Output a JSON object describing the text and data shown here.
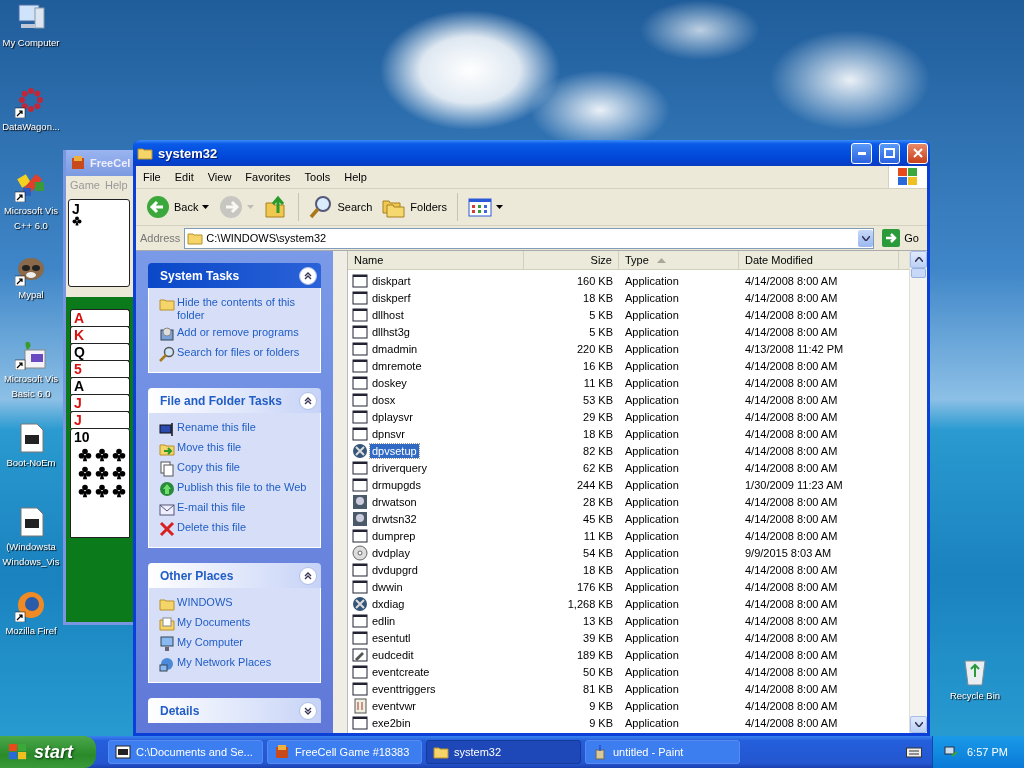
{
  "desktop_icons": [
    {
      "label_lines": [
        "My Computer"
      ],
      "kind": "computer",
      "shortcut": false
    },
    {
      "label_lines": [
        "DataWagon..."
      ],
      "kind": "dots",
      "shortcut": true
    },
    {
      "label_lines": [
        "Microsoft Vis",
        "C++ 6.0"
      ],
      "kind": "blocks",
      "shortcut": true
    },
    {
      "label_lines": [
        "Mypal"
      ],
      "kind": "raccoon",
      "shortcut": true
    },
    {
      "label_lines": [
        "Microsoft Vis",
        "Basic 6.0"
      ],
      "kind": "plant",
      "shortcut": true
    },
    {
      "label_lines": [
        "Boot-NoEm"
      ],
      "kind": "archive",
      "shortcut": false
    },
    {
      "label_lines": [
        "(Windowsta",
        "Windows_Vis"
      ],
      "kind": "archive",
      "shortcut": false
    },
    {
      "label_lines": [
        "Mozilla Firef"
      ],
      "kind": "firefox",
      "shortcut": true
    }
  ],
  "recycle_bin": {
    "label": "Recycle Bin"
  },
  "freecell": {
    "title": "FreeCel",
    "menu": [
      "Game",
      "Help"
    ],
    "free_card": {
      "rank": "J",
      "color": "#000000"
    },
    "column": [
      {
        "rank": "A",
        "color": "#d81010"
      },
      {
        "rank": "K",
        "color": "#d81010"
      },
      {
        "rank": "Q",
        "color": "#000000"
      },
      {
        "rank": "5",
        "color": "#d81010"
      },
      {
        "rank": "A",
        "color": "#000000"
      },
      {
        "rank": "J",
        "color": "#d81010"
      },
      {
        "rank": "J",
        "color": "#d81010"
      },
      {
        "rank": "10",
        "color": "#000000"
      }
    ]
  },
  "window": {
    "title": "system32",
    "menu": [
      "File",
      "Edit",
      "View",
      "Favorites",
      "Tools",
      "Help"
    ],
    "toolbar": [
      {
        "kind": "back",
        "label": "Back",
        "disabled": false
      },
      {
        "kind": "forward",
        "disabled": true
      },
      {
        "kind": "up",
        "disabled": false
      },
      {
        "kind": "search",
        "label": "Search",
        "disabled": false
      },
      {
        "kind": "folders",
        "label": "Folders",
        "disabled": false
      },
      {
        "kind": "views",
        "disabled": false
      }
    ],
    "address": {
      "label": "Address",
      "value": "C:\\WINDOWS\\system32",
      "go": "Go"
    },
    "task_panels": [
      {
        "title": "System Tasks",
        "expanded": true,
        "kind": "primary",
        "items": [
          {
            "label": "Hide the contents of this folder",
            "kind": "hide"
          },
          {
            "label": "Add or remove programs",
            "kind": "addremove"
          },
          {
            "label": "Search for files or folders",
            "kind": "search"
          }
        ]
      },
      {
        "title": "File and Folder Tasks",
        "expanded": true,
        "kind": "plain",
        "items": [
          {
            "label": "Rename this file",
            "kind": "rename"
          },
          {
            "label": "Move this file",
            "kind": "move"
          },
          {
            "label": "Copy this file",
            "kind": "copy"
          },
          {
            "label": "Publish this file to the Web",
            "kind": "publish"
          },
          {
            "label": "E-mail this file",
            "kind": "email"
          },
          {
            "label": "Delete this file",
            "kind": "delete"
          }
        ]
      },
      {
        "title": "Other Places",
        "expanded": true,
        "kind": "plain",
        "items": [
          {
            "label": "WINDOWS",
            "kind": "folder"
          },
          {
            "label": "My Documents",
            "kind": "documents"
          },
          {
            "label": "My Computer",
            "kind": "computer"
          },
          {
            "label": "My Network Places",
            "kind": "network"
          }
        ]
      },
      {
        "title": "Details",
        "expanded": false,
        "kind": "plain"
      }
    ],
    "columns": [
      {
        "label": "Name",
        "sorted": false
      },
      {
        "label": "Size",
        "sorted": false
      },
      {
        "label": "Type",
        "sorted": true
      },
      {
        "label": "Date Modified",
        "sorted": false
      }
    ],
    "files": [
      {
        "name": "diskpart",
        "size": "160 KB",
        "type": "Application",
        "date": "4/14/2008 8:00 AM",
        "kind": "window",
        "selected": false
      },
      {
        "name": "diskperf",
        "size": "18 KB",
        "type": "Application",
        "date": "4/14/2008 8:00 AM",
        "kind": "window",
        "selected": false
      },
      {
        "name": "dllhost",
        "size": "5 KB",
        "type": "Application",
        "date": "4/14/2008 8:00 AM",
        "kind": "window",
        "selected": false
      },
      {
        "name": "dllhst3g",
        "size": "5 KB",
        "type": "Application",
        "date": "4/14/2008 8:00 AM",
        "kind": "window",
        "selected": false
      },
      {
        "name": "dmadmin",
        "size": "220 KB",
        "type": "Application",
        "date": "4/13/2008 11:42 PM",
        "kind": "window",
        "selected": false
      },
      {
        "name": "dmremote",
        "size": "16 KB",
        "type": "Application",
        "date": "4/14/2008 8:00 AM",
        "kind": "window",
        "selected": false
      },
      {
        "name": "doskey",
        "size": "11 KB",
        "type": "Application",
        "date": "4/14/2008 8:00 AM",
        "kind": "window",
        "selected": false
      },
      {
        "name": "dosx",
        "size": "53 KB",
        "type": "Application",
        "date": "4/14/2008 8:00 AM",
        "kind": "window",
        "selected": false
      },
      {
        "name": "dplaysvr",
        "size": "29 KB",
        "type": "Application",
        "date": "4/14/2008 8:00 AM",
        "kind": "window",
        "selected": false
      },
      {
        "name": "dpnsvr",
        "size": "18 KB",
        "type": "Application",
        "date": "4/14/2008 8:00 AM",
        "kind": "window",
        "selected": false
      },
      {
        "name": "dpvsetup",
        "size": "82 KB",
        "type": "Application",
        "date": "4/14/2008 8:00 AM",
        "kind": "xball",
        "selected": true
      },
      {
        "name": "driverquery",
        "size": "62 KB",
        "type": "Application",
        "date": "4/14/2008 8:00 AM",
        "kind": "window",
        "selected": false
      },
      {
        "name": "drmupgds",
        "size": "244 KB",
        "type": "Application",
        "date": "1/30/2009 11:23 AM",
        "kind": "window",
        "selected": false
      },
      {
        "name": "drwatson",
        "size": "28 KB",
        "type": "Application",
        "date": "4/14/2008 8:00 AM",
        "kind": "doctor",
        "selected": false
      },
      {
        "name": "drwtsn32",
        "size": "45 KB",
        "type": "Application",
        "date": "4/14/2008 8:00 AM",
        "kind": "doctor",
        "selected": false
      },
      {
        "name": "dumprep",
        "size": "11 KB",
        "type": "Application",
        "date": "4/14/2008 8:00 AM",
        "kind": "window",
        "selected": false
      },
      {
        "name": "dvdplay",
        "size": "54 KB",
        "type": "Application",
        "date": "9/9/2015 8:03 AM",
        "kind": "disc",
        "selected": false
      },
      {
        "name": "dvdupgrd",
        "size": "18 KB",
        "type": "Application",
        "date": "4/14/2008 8:00 AM",
        "kind": "window",
        "selected": false
      },
      {
        "name": "dwwin",
        "size": "176 KB",
        "type": "Application",
        "date": "4/14/2008 8:00 AM",
        "kind": "window",
        "selected": false
      },
      {
        "name": "dxdiag",
        "size": "1,268 KB",
        "type": "Application",
        "date": "4/14/2008 8:00 AM",
        "kind": "xball",
        "selected": false
      },
      {
        "name": "edlin",
        "size": "13 KB",
        "type": "Application",
        "date": "4/14/2008 8:00 AM",
        "kind": "window",
        "selected": false
      },
      {
        "name": "esentutl",
        "size": "39 KB",
        "type": "Application",
        "date": "4/14/2008 8:00 AM",
        "kind": "window",
        "selected": false
      },
      {
        "name": "eudcedit",
        "size": "189 KB",
        "type": "Application",
        "date": "4/14/2008 8:00 AM",
        "kind": "pen",
        "selected": false
      },
      {
        "name": "eventcreate",
        "size": "50 KB",
        "type": "Application",
        "date": "4/14/2008 8:00 AM",
        "kind": "window",
        "selected": false
      },
      {
        "name": "eventtriggers",
        "size": "81 KB",
        "type": "Application",
        "date": "4/14/2008 8:00 AM",
        "kind": "window",
        "selected": false
      },
      {
        "name": "eventvwr",
        "size": "9 KB",
        "type": "Application",
        "date": "4/14/2008 8:00 AM",
        "kind": "log",
        "selected": false
      },
      {
        "name": "exe2bin",
        "size": "9 KB",
        "type": "Application",
        "date": "4/14/2008 8:00 AM",
        "kind": "window",
        "selected": false
      }
    ]
  },
  "taskbar": {
    "start": "start",
    "tasks": [
      {
        "label": "C:\\Documents and Se...",
        "kind": "archive",
        "selected": false
      },
      {
        "label": "FreeCell Game #18383",
        "kind": "cards",
        "selected": false
      },
      {
        "label": "system32",
        "kind": "folder",
        "selected": true
      },
      {
        "label": "untitled - Paint",
        "kind": "paint",
        "selected": false
      }
    ],
    "clock": "6:57 PM"
  }
}
